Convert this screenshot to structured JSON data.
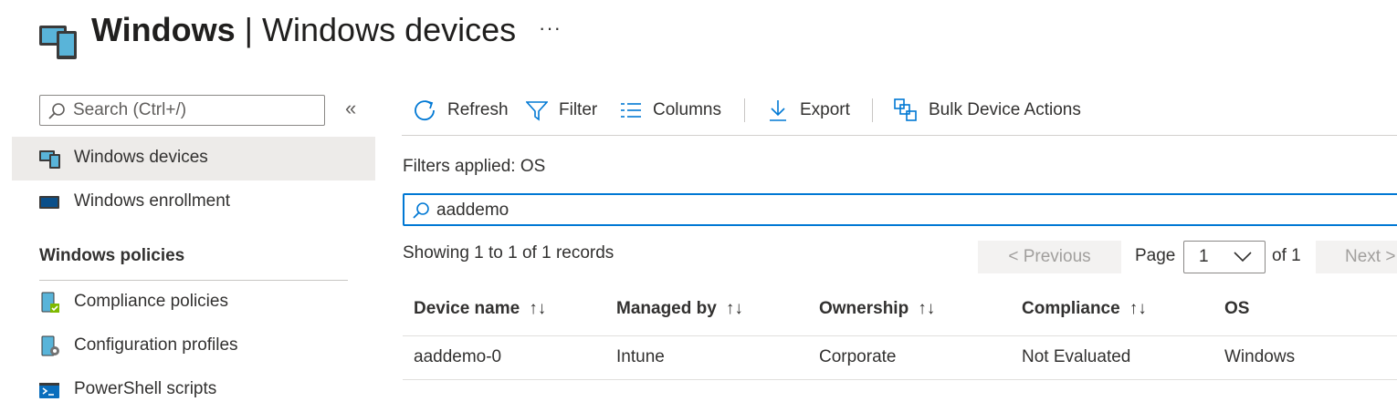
{
  "header": {
    "title_bold": "Windows",
    "title_separator": " | ",
    "title_rest": "Windows devices",
    "more_label": "···"
  },
  "sidebar": {
    "search_placeholder": "Search (Ctrl+/)",
    "collapse_label": "«",
    "items": [
      {
        "label": "Windows devices",
        "icon": "windows-devices-icon",
        "active": true
      },
      {
        "label": "Windows enrollment",
        "icon": "monitor-icon"
      }
    ],
    "section_title": "Windows policies",
    "policy_items": [
      {
        "label": "Compliance policies",
        "icon": "compliance-icon"
      },
      {
        "label": "Configuration profiles",
        "icon": "configuration-icon"
      },
      {
        "label": "PowerShell scripts",
        "icon": "powershell-icon"
      }
    ]
  },
  "toolbar": {
    "refresh": "Refresh",
    "filter": "Filter",
    "columns": "Columns",
    "export": "Export",
    "bulk": "Bulk Device Actions"
  },
  "filters": {
    "applied_text": "Filters applied: OS",
    "search_value": "aaddemo"
  },
  "pagination": {
    "showing": "Showing 1 to 1 of 1 records",
    "previous": "< Previous",
    "page_label": "Page",
    "page_value": "1",
    "of_label": "of 1",
    "next": "Next >"
  },
  "table": {
    "columns": [
      "Device name",
      "Managed by",
      "Ownership",
      "Compliance",
      "OS"
    ],
    "sort_glyph": "↑↓",
    "rows": [
      [
        "aaddemo-0",
        "Intune",
        "Corporate",
        "Not Evaluated",
        "Windows"
      ]
    ]
  },
  "colors": {
    "accent": "#0078d4",
    "active_bg": "#edebe9"
  }
}
